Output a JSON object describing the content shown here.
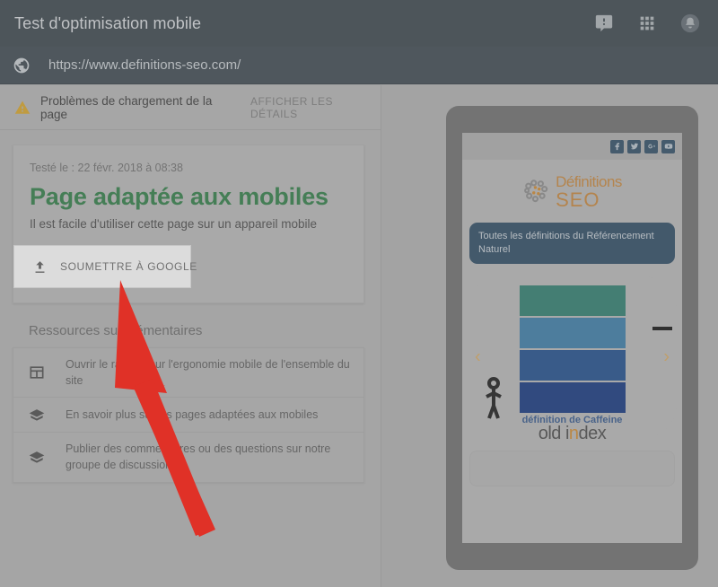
{
  "header": {
    "title": "Test d'optimisation mobile",
    "icons": [
      "feedback-icon",
      "apps-grid-icon",
      "notifications-bell-icon"
    ]
  },
  "urlbar": {
    "icon": "globe-icon",
    "url": "https://www.definitions-seo.com/"
  },
  "warning": {
    "icon": "warning-triangle-icon",
    "text": "Problèmes de chargement de la page",
    "link": "AFFICHER LES DÉTAILS"
  },
  "result": {
    "tested_on": "Testé le : 22 févr. 2018 à 08:38",
    "verdict": "Page adaptée aux mobiles",
    "verdict_color": "#2f7d46",
    "subtitle": "Il est facile d'utiliser cette page sur un appareil mobile",
    "submit_label": "SOUMETTRE À GOOGLE",
    "submit_icon": "upload-icon"
  },
  "resources": {
    "title": "Ressources supplémentaires",
    "items": [
      {
        "icon": "dashboard-report-icon",
        "label": "Ouvrir le rapport sur l'ergonomie mobile de l'ensemble du site"
      },
      {
        "icon": "graduation-cap-icon",
        "label": "En savoir plus sur les pages adaptées aux mobiles"
      },
      {
        "icon": "graduation-cap-icon",
        "label": "Publier des commentaires ou des questions sur notre groupe de discussion"
      }
    ]
  },
  "preview": {
    "social": [
      "facebook-icon",
      "twitter-icon",
      "google-plus-icon",
      "youtube-icon"
    ],
    "logo_line1": "Définitions",
    "logo_line2": "SEO",
    "logo_color": "#c8863a",
    "banner": "Toutes les définitions du Référencement Naturel",
    "banner_color": "#2c4a63",
    "arrow_left": "‹",
    "arrow_right": "›",
    "bands": [
      "#2d7d6e",
      "#3a7ca8",
      "#1e4d8c",
      "#12357e"
    ],
    "caption_top": "définition de Caffeine",
    "caption_main_a": "old i",
    "caption_main_dot": "n",
    "caption_main_b": "dex"
  },
  "annotation": {
    "arrow_color": "#e03127"
  }
}
